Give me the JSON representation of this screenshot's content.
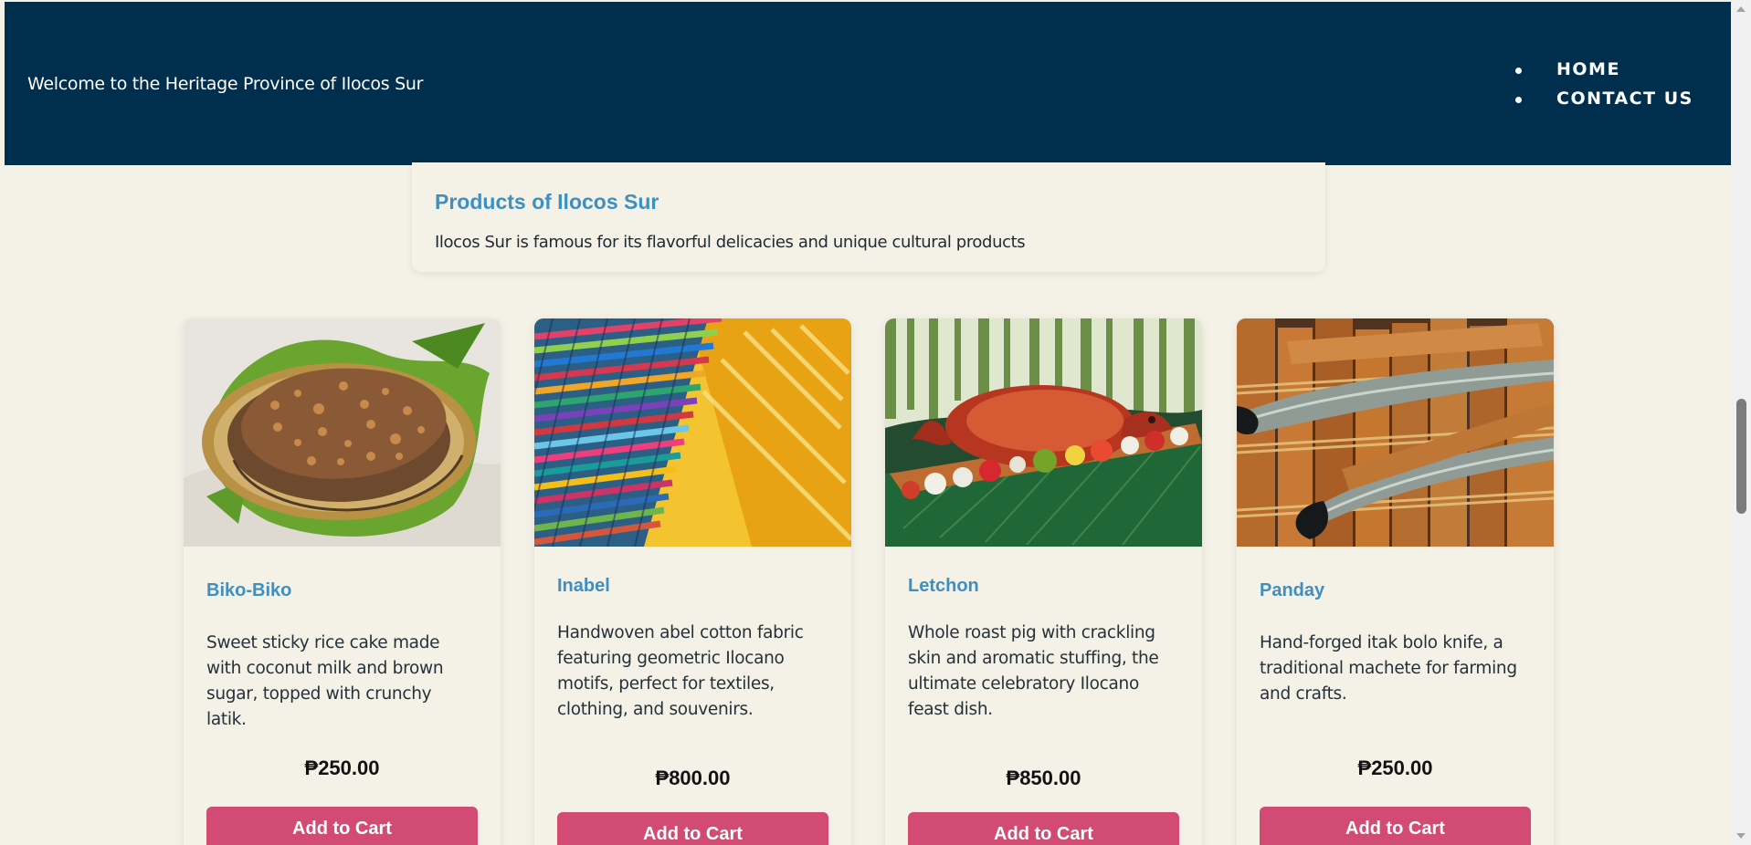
{
  "header": {
    "welcome_text": "Welcome to the Heritage Province of Ilocos Sur",
    "nav_items": [
      {
        "label": "HOME"
      },
      {
        "label": "CONTACT US"
      }
    ]
  },
  "intro": {
    "title": "Products of Ilocos Sur",
    "description": "Ilocos Sur is famous for its flavorful delicacies and unique cultural products"
  },
  "products": [
    {
      "name": "Biko-Biko",
      "description": "Sweet sticky rice cake made with coconut milk and brown sugar, topped with crunchy latik.",
      "price": "₱250.00",
      "button_label": "Add to Cart",
      "image_icon": "biko-image"
    },
    {
      "name": "Inabel",
      "description": "Handwoven abel cotton fabric featuring geometric Ilocano motifs, perfect for textiles, clothing, and souvenirs.",
      "price": "₱800.00",
      "button_label": "Add to Cart",
      "image_icon": "inabel-image"
    },
    {
      "name": "Letchon",
      "description": "Whole roast pig with crackling skin and aromatic stuffing, the ultimate celebratory Ilocano feast dish.",
      "price": "₱850.00",
      "button_label": "Add to Cart",
      "image_icon": "letchon-image"
    },
    {
      "name": "Panday",
      "description": "Hand-forged itak bolo knife, a traditional machete for farming and crafts.",
      "price": "₱250.00",
      "button_label": "Add to Cart",
      "image_icon": "panday-image"
    }
  ],
  "colors": {
    "header_bg": "#002e4d",
    "page_bg": "#f4f1e6",
    "accent_blue": "#3f8fc0",
    "button_pink": "#d14b74"
  }
}
